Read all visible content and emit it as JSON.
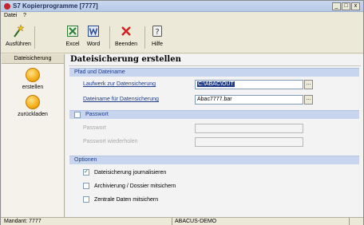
{
  "window": {
    "title": "S7 Kopierprogramme [7777]",
    "minimize": "_",
    "maximize": "□",
    "close": "x"
  },
  "menu": {
    "items": [
      "Datei",
      "?"
    ]
  },
  "toolbar": {
    "run": "Ausführen",
    "excel": "Excel",
    "word": "Word",
    "quit": "Beenden",
    "help": "Hilfe"
  },
  "sidebar": {
    "header": "Dateisicherung",
    "items": [
      "erstellen",
      "zurückladen"
    ]
  },
  "main": {
    "title": "Dateisicherung erstellen",
    "sections": {
      "path": "Pfad und Dateiname",
      "password": "Passwort",
      "options": "Optionen"
    },
    "fields": {
      "drive_label": "Laufwerk zur Datensicherung",
      "drive_value": "C:\\ABAC\\OUT",
      "file_label": "Dateiname für Datensicherung",
      "file_value": "Abac7777.bar",
      "browse": "...",
      "password_label": "Passwort",
      "password_repeat_label": "Passwort wiederholen"
    },
    "options": [
      {
        "label": "Dateisicherung journalisieren",
        "checked": true
      },
      {
        "label": "Archivierung / Dossier mitsichern",
        "checked": false
      },
      {
        "label": "Zentrale Daten mitsichern",
        "checked": false
      }
    ],
    "checkmark": "✓"
  },
  "status": {
    "mandant": "Mandant: 7777",
    "company": "ABACUS-DEMO"
  }
}
